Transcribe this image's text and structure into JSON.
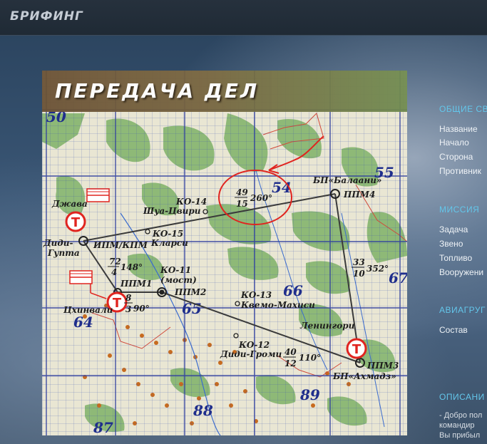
{
  "topbar": {
    "title": "БРИФИНГ"
  },
  "map": {
    "header_title": "ПЕРЕДАЧА ДЕЛ",
    "grid_numbers": [
      "50",
      "55",
      "54",
      "66",
      "65",
      "64",
      "67",
      "88",
      "89",
      "87"
    ],
    "places": {
      "dzhava": "Джава",
      "didi_gupta_1": "Диди-",
      "didi_gupta_2": "Гупта",
      "tskhinvali": "Цхинвали",
      "shua_tsviri": "Шуа-Цвири",
      "klarsi": "Кларси",
      "kvemo_makhisi": "Квемо-Махиси",
      "leningori": "Ленингори",
      "didi_gromi": "Диди-Громи"
    },
    "checkpoints": {
      "ko14": "КО-14",
      "ko15": "КО-15",
      "ko11": "КО-11",
      "ko11_sub": "(мост)",
      "ko13": "КО-13",
      "ko12": "КО-12"
    },
    "waypoints": {
      "ipm_kpm": "ИПМ/КПМ",
      "ppm1": "ППМ1",
      "ppm2": "ППМ2",
      "ppm3": "ППМ3",
      "ppm4": "ППМ4",
      "bp_balaani": "БП«Балаани»",
      "bp_akhmadz": "БП«Ахмадз»"
    },
    "legs": {
      "leg1_top": "72",
      "leg1_bottom": "4",
      "leg1_course": "148°",
      "leg2_top": "8",
      "leg2_bottom": "3",
      "leg2_course": "90°",
      "leg3_top": "40",
      "leg3_bottom": "12",
      "leg3_course": "110°",
      "leg4_top": "33",
      "leg4_bottom": "10",
      "leg4_course": "352°",
      "leg5_top": "49",
      "leg5_bottom": "15",
      "leg5_course": "260°"
    },
    "marker_letter": "T"
  },
  "sidebar": {
    "general": {
      "heading": "ОБЩИЕ СВ",
      "items": [
        "Название",
        "Начало",
        "Сторона",
        "Противник"
      ]
    },
    "mission": {
      "heading": "МИССИЯ",
      "items": [
        "Задача",
        "Звено",
        "Топливо",
        "Вооружени"
      ]
    },
    "airgroup": {
      "heading": "АВИАГРУГ",
      "items": [
        "Состав"
      ]
    },
    "description": {
      "heading": "ОПИСАНИ",
      "lines": [
        "- Добро пол",
        "командир",
        "Вы прибыл"
      ]
    }
  },
  "colors": {
    "accent_heading": "#63c6ea",
    "route_line": "#3a3a3a",
    "marker_red": "#e0241f",
    "annotation_red": "#e0241f"
  }
}
